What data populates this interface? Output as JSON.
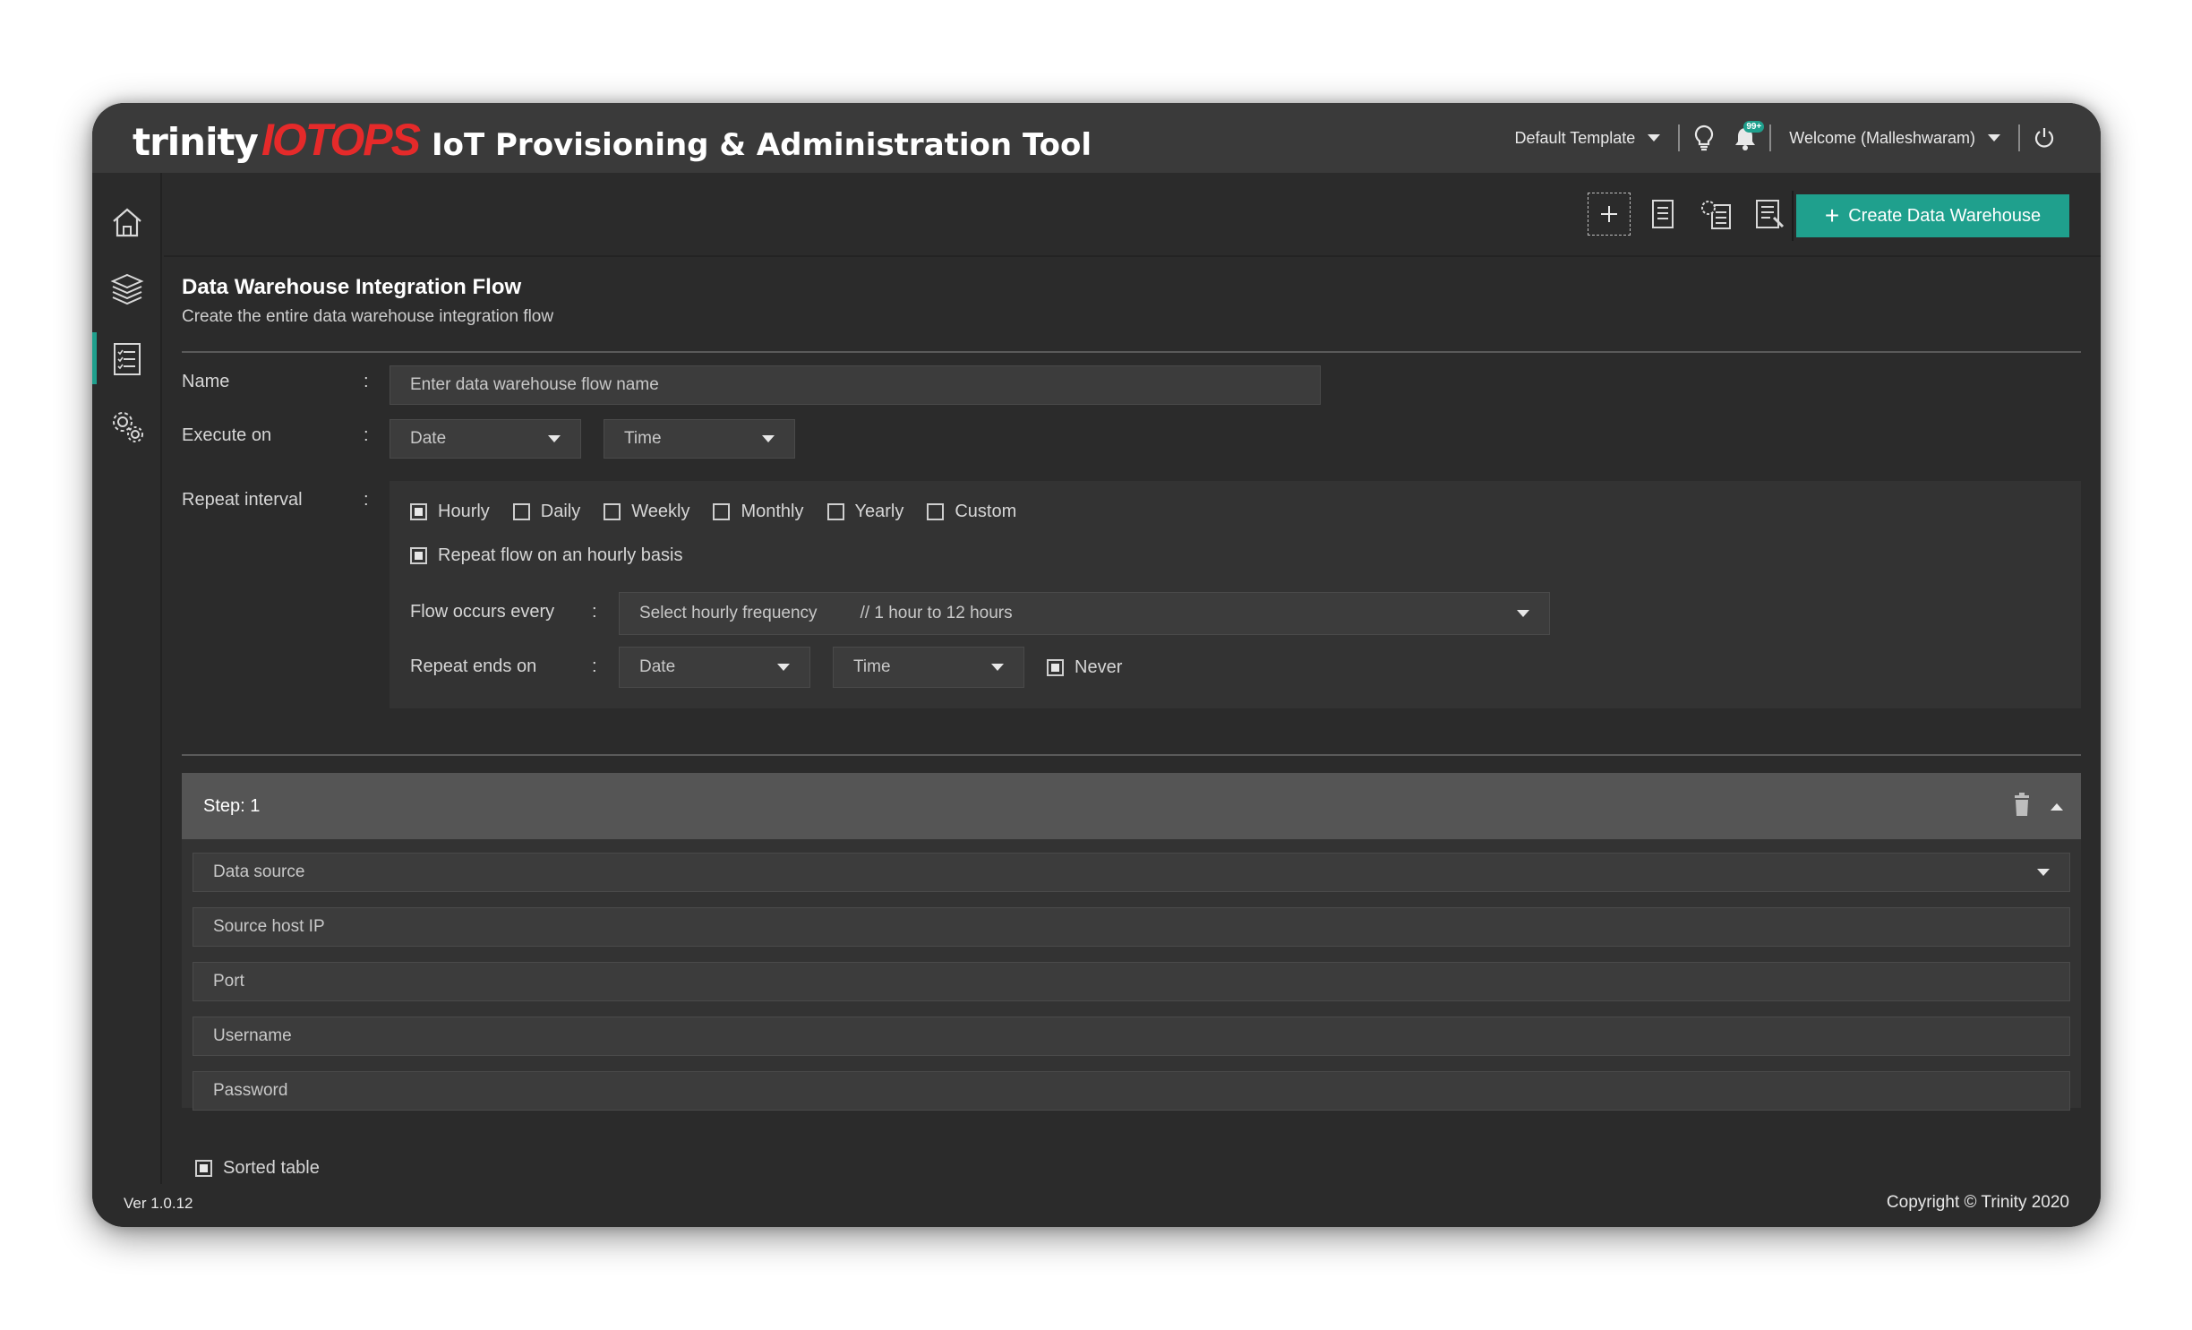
{
  "header": {
    "brand_trinity": "trinity",
    "brand_iotops": "IOTOPS",
    "app_title": "IoT Provisioning & Administration Tool",
    "template_label": "Default Template",
    "notification_badge": "99+",
    "welcome_label": "Welcome (Malleshwaram)"
  },
  "sidebar": {
    "items": [
      {
        "icon": "home-icon"
      },
      {
        "icon": "layers-icon"
      },
      {
        "icon": "checklist-icon"
      },
      {
        "icon": "settings-icon"
      }
    ],
    "active_index": 2
  },
  "toolbar": {
    "create_label": "Create Data Warehouse"
  },
  "page": {
    "title": "Data Warehouse Integration Flow",
    "subtitle": "Create the entire data warehouse integration flow"
  },
  "form": {
    "name_label": "Name",
    "name_placeholder": "Enter data warehouse flow name",
    "execute_label": "Execute on",
    "execute_date": "Date",
    "execute_time": "Time",
    "repeat_label": "Repeat interval",
    "colon": ":",
    "intervals": [
      {
        "label": "Hourly",
        "checked": true
      },
      {
        "label": "Daily",
        "checked": false
      },
      {
        "label": "Weekly",
        "checked": false
      },
      {
        "label": "Monthly",
        "checked": false
      },
      {
        "label": "Yearly",
        "checked": false
      },
      {
        "label": "Custom",
        "checked": false
      }
    ],
    "repeat_hourly_label": "Repeat flow on an hourly basis",
    "flow_occurs_label": "Flow occurs every",
    "frequency_placeholder": "Select hourly frequency",
    "frequency_hint": "// 1 hour to 12 hours",
    "repeat_ends_label": "Repeat ends on",
    "ends_date": "Date",
    "ends_time": "Time",
    "never_label": "Never"
  },
  "step": {
    "title": "Step: 1",
    "data_source": "Data source",
    "source_host": "Source host IP",
    "port": "Port",
    "username": "Username",
    "password": "Password",
    "sorted_label": "Sorted table"
  },
  "footer": {
    "version": "Ver 1.0.12",
    "copyright": "Copyright © Trinity 2020"
  },
  "colors": {
    "accent": "#1fa08d",
    "brand_red": "#e52a2a",
    "panel": "#2b2b2b",
    "header": "#3a3a3a"
  }
}
